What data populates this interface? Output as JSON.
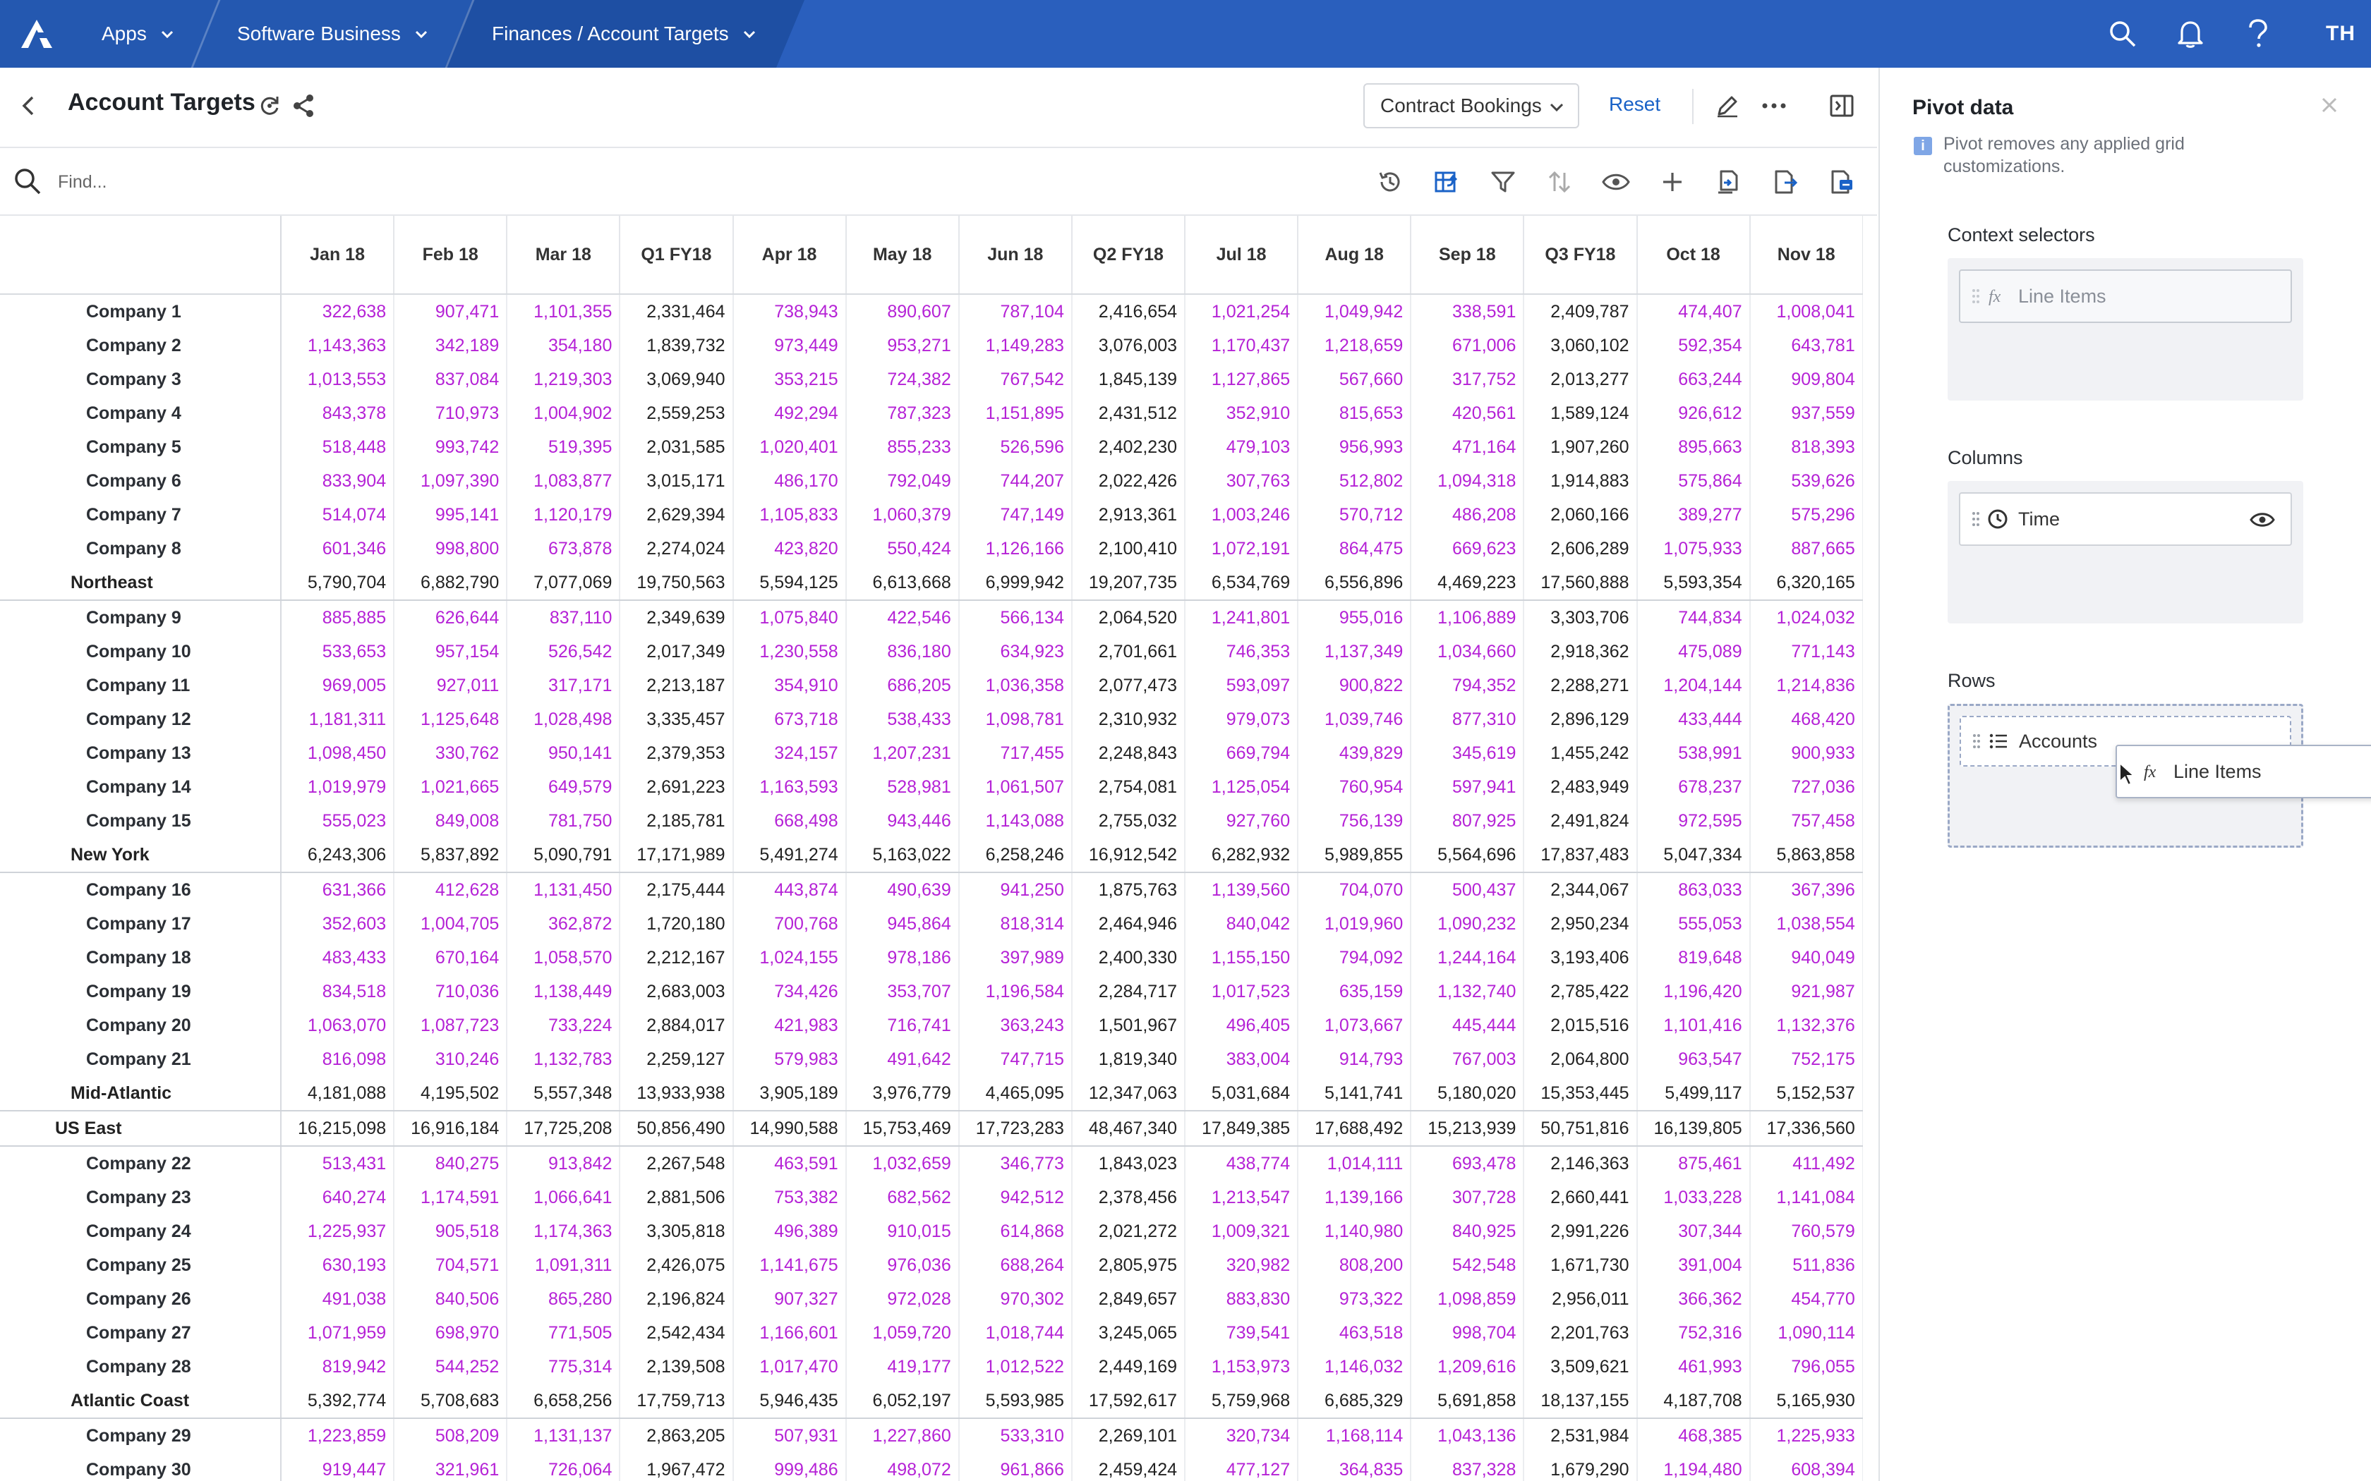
{
  "topbar": {
    "apps": "Apps",
    "workspace": "Software Business",
    "model": "Finances / Account Targets",
    "user_initials": "TH",
    "icons": [
      "search-icon",
      "bell-icon",
      "help-icon"
    ]
  },
  "header": {
    "title": "Account Targets",
    "view_selector": "Contract Bookings",
    "reset": "Reset"
  },
  "search": {
    "placeholder": "Find..."
  },
  "grid": {
    "columns": [
      "Jan 18",
      "Feb 18",
      "Mar 18",
      "Q1 FY18",
      "Apr 18",
      "May 18",
      "Jun 18",
      "Q2 FY18",
      "Jul 18",
      "Aug 18",
      "Sep 18",
      "Q3 FY18",
      "Oct 18",
      "Nov 18"
    ],
    "rows": [
      {
        "label": "Company 1",
        "type": "company",
        "values": [
          "322,638",
          "907,471",
          "1,101,355",
          "2,331,464",
          "738,943",
          "890,607",
          "787,104",
          "2,416,654",
          "1,021,254",
          "1,049,942",
          "338,591",
          "2,409,787",
          "474,407",
          "1,008,041"
        ]
      },
      {
        "label": "Company 2",
        "type": "company",
        "values": [
          "1,143,363",
          "342,189",
          "354,180",
          "1,839,732",
          "973,449",
          "953,271",
          "1,149,283",
          "3,076,003",
          "1,170,437",
          "1,218,659",
          "671,006",
          "3,060,102",
          "592,354",
          "643,781"
        ]
      },
      {
        "label": "Company 3",
        "type": "company",
        "values": [
          "1,013,553",
          "837,084",
          "1,219,303",
          "3,069,940",
          "353,215",
          "724,382",
          "767,542",
          "1,845,139",
          "1,127,865",
          "567,660",
          "317,752",
          "2,013,277",
          "663,244",
          "909,804"
        ]
      },
      {
        "label": "Company 4",
        "type": "company",
        "values": [
          "843,378",
          "710,973",
          "1,004,902",
          "2,559,253",
          "492,294",
          "787,323",
          "1,151,895",
          "2,431,512",
          "352,910",
          "815,653",
          "420,561",
          "1,589,124",
          "926,612",
          "937,559"
        ]
      },
      {
        "label": "Company 5",
        "type": "company",
        "values": [
          "518,448",
          "993,742",
          "519,395",
          "2,031,585",
          "1,020,401",
          "855,233",
          "526,596",
          "2,402,230",
          "479,103",
          "956,993",
          "471,164",
          "1,907,260",
          "895,663",
          "818,393"
        ]
      },
      {
        "label": "Company 6",
        "type": "company",
        "values": [
          "833,904",
          "1,097,390",
          "1,083,877",
          "3,015,171",
          "486,170",
          "792,049",
          "744,207",
          "2,022,426",
          "307,763",
          "512,802",
          "1,094,318",
          "1,914,883",
          "575,864",
          "539,626"
        ]
      },
      {
        "label": "Company 7",
        "type": "company",
        "values": [
          "514,074",
          "995,141",
          "1,120,179",
          "2,629,394",
          "1,105,833",
          "1,060,379",
          "747,149",
          "2,913,361",
          "1,003,246",
          "570,712",
          "486,208",
          "2,060,166",
          "389,277",
          "575,296"
        ]
      },
      {
        "label": "Company 8",
        "type": "company",
        "values": [
          "601,346",
          "998,800",
          "673,878",
          "2,274,024",
          "423,820",
          "550,424",
          "1,126,166",
          "2,100,410",
          "1,072,191",
          "864,475",
          "669,623",
          "2,606,289",
          "1,075,933",
          "887,665"
        ]
      },
      {
        "label": "Northeast",
        "type": "region",
        "values": [
          "5,790,704",
          "6,882,790",
          "7,077,069",
          "19,750,563",
          "5,594,125",
          "6,613,668",
          "6,999,942",
          "19,207,735",
          "6,534,769",
          "6,556,896",
          "4,469,223",
          "17,560,888",
          "5,593,354",
          "6,320,165"
        ]
      },
      {
        "label": "Company 9",
        "type": "company",
        "values": [
          "885,885",
          "626,644",
          "837,110",
          "2,349,639",
          "1,075,840",
          "422,546",
          "566,134",
          "2,064,520",
          "1,241,801",
          "955,016",
          "1,106,889",
          "3,303,706",
          "744,834",
          "1,024,032"
        ]
      },
      {
        "label": "Company 10",
        "type": "company",
        "values": [
          "533,653",
          "957,154",
          "526,542",
          "2,017,349",
          "1,230,558",
          "836,180",
          "634,923",
          "2,701,661",
          "746,353",
          "1,137,349",
          "1,034,660",
          "2,918,362",
          "475,089",
          "771,143"
        ]
      },
      {
        "label": "Company 11",
        "type": "company",
        "values": [
          "969,005",
          "927,011",
          "317,171",
          "2,213,187",
          "354,910",
          "686,205",
          "1,036,358",
          "2,077,473",
          "593,097",
          "900,822",
          "794,352",
          "2,288,271",
          "1,204,144",
          "1,214,836"
        ]
      },
      {
        "label": "Company 12",
        "type": "company",
        "values": [
          "1,181,311",
          "1,125,648",
          "1,028,498",
          "3,335,457",
          "673,718",
          "538,433",
          "1,098,781",
          "2,310,932",
          "979,073",
          "1,039,746",
          "877,310",
          "2,896,129",
          "433,444",
          "468,420"
        ]
      },
      {
        "label": "Company 13",
        "type": "company",
        "values": [
          "1,098,450",
          "330,762",
          "950,141",
          "2,379,353",
          "324,157",
          "1,207,231",
          "717,455",
          "2,248,843",
          "669,794",
          "439,829",
          "345,619",
          "1,455,242",
          "538,991",
          "900,933"
        ]
      },
      {
        "label": "Company 14",
        "type": "company",
        "values": [
          "1,019,979",
          "1,021,665",
          "649,579",
          "2,691,223",
          "1,163,593",
          "528,981",
          "1,061,507",
          "2,754,081",
          "1,125,054",
          "760,954",
          "597,941",
          "2,483,949",
          "678,237",
          "727,036"
        ]
      },
      {
        "label": "Company 15",
        "type": "company",
        "values": [
          "555,023",
          "849,008",
          "781,750",
          "2,185,781",
          "668,498",
          "943,446",
          "1,143,088",
          "2,755,032",
          "927,760",
          "756,139",
          "807,925",
          "2,491,824",
          "972,595",
          "757,458"
        ]
      },
      {
        "label": "New York",
        "type": "region",
        "values": [
          "6,243,306",
          "5,837,892",
          "5,090,791",
          "17,171,989",
          "5,491,274",
          "5,163,022",
          "6,258,246",
          "16,912,542",
          "6,282,932",
          "5,989,855",
          "5,564,696",
          "17,837,483",
          "5,047,334",
          "5,863,858"
        ]
      },
      {
        "label": "Company 16",
        "type": "company",
        "values": [
          "631,366",
          "412,628",
          "1,131,450",
          "2,175,444",
          "443,874",
          "490,639",
          "941,250",
          "1,875,763",
          "1,139,560",
          "704,070",
          "500,437",
          "2,344,067",
          "863,033",
          "367,396"
        ]
      },
      {
        "label": "Company 17",
        "type": "company",
        "values": [
          "352,603",
          "1,004,705",
          "362,872",
          "1,720,180",
          "700,768",
          "945,864",
          "818,314",
          "2,464,946",
          "840,042",
          "1,019,960",
          "1,090,232",
          "2,950,234",
          "555,053",
          "1,038,554"
        ]
      },
      {
        "label": "Company 18",
        "type": "company",
        "values": [
          "483,433",
          "670,164",
          "1,058,570",
          "2,212,167",
          "1,024,155",
          "978,186",
          "397,989",
          "2,400,330",
          "1,155,150",
          "794,092",
          "1,244,164",
          "3,193,406",
          "819,648",
          "940,049"
        ]
      },
      {
        "label": "Company 19",
        "type": "company",
        "values": [
          "834,518",
          "710,036",
          "1,138,449",
          "2,683,003",
          "734,426",
          "353,707",
          "1,196,584",
          "2,284,717",
          "1,017,523",
          "635,159",
          "1,132,740",
          "2,785,422",
          "1,196,420",
          "921,987"
        ]
      },
      {
        "label": "Company 20",
        "type": "company",
        "values": [
          "1,063,070",
          "1,087,723",
          "733,224",
          "2,884,017",
          "421,983",
          "716,741",
          "363,243",
          "1,501,967",
          "496,405",
          "1,073,667",
          "445,444",
          "2,015,516",
          "1,101,416",
          "1,132,376"
        ]
      },
      {
        "label": "Company 21",
        "type": "company",
        "values": [
          "816,098",
          "310,246",
          "1,132,783",
          "2,259,127",
          "579,983",
          "491,642",
          "747,715",
          "1,819,340",
          "383,004",
          "914,793",
          "767,003",
          "2,064,800",
          "963,547",
          "752,175"
        ]
      },
      {
        "label": "Mid-Atlantic",
        "type": "region",
        "values": [
          "4,181,088",
          "4,195,502",
          "5,557,348",
          "13,933,938",
          "3,905,189",
          "3,976,779",
          "4,465,095",
          "12,347,063",
          "5,031,684",
          "5,141,741",
          "5,180,020",
          "15,353,445",
          "5,499,117",
          "5,152,537"
        ]
      },
      {
        "label": "US East",
        "type": "total",
        "values": [
          "16,215,098",
          "16,916,184",
          "17,725,208",
          "50,856,490",
          "14,990,588",
          "15,753,469",
          "17,723,283",
          "48,467,340",
          "17,849,385",
          "17,688,492",
          "15,213,939",
          "50,751,816",
          "16,139,805",
          "17,336,560"
        ]
      },
      {
        "label": "Company 22",
        "type": "company",
        "values": [
          "513,431",
          "840,275",
          "913,842",
          "2,267,548",
          "463,591",
          "1,032,659",
          "346,773",
          "1,843,023",
          "438,774",
          "1,014,111",
          "693,478",
          "2,146,363",
          "875,461",
          "411,492"
        ]
      },
      {
        "label": "Company 23",
        "type": "company",
        "values": [
          "640,274",
          "1,174,591",
          "1,066,641",
          "2,881,506",
          "753,382",
          "682,562",
          "942,512",
          "2,378,456",
          "1,213,547",
          "1,139,166",
          "307,728",
          "2,660,441",
          "1,033,228",
          "1,141,084"
        ]
      },
      {
        "label": "Company 24",
        "type": "company",
        "values": [
          "1,225,937",
          "905,518",
          "1,174,363",
          "3,305,818",
          "496,389",
          "910,015",
          "614,868",
          "2,021,272",
          "1,009,321",
          "1,140,980",
          "840,925",
          "2,991,226",
          "307,344",
          "760,579"
        ]
      },
      {
        "label": "Company 25",
        "type": "company",
        "values": [
          "630,193",
          "704,571",
          "1,091,311",
          "2,426,075",
          "1,141,675",
          "976,036",
          "688,264",
          "2,805,975",
          "320,982",
          "808,200",
          "542,548",
          "1,671,730",
          "391,004",
          "511,836"
        ]
      },
      {
        "label": "Company 26",
        "type": "company",
        "values": [
          "491,038",
          "840,506",
          "865,280",
          "2,196,824",
          "907,327",
          "972,028",
          "970,302",
          "2,849,657",
          "883,830",
          "973,322",
          "1,098,859",
          "2,956,011",
          "366,362",
          "454,770"
        ]
      },
      {
        "label": "Company 27",
        "type": "company",
        "values": [
          "1,071,959",
          "698,970",
          "771,505",
          "2,542,434",
          "1,166,601",
          "1,059,720",
          "1,018,744",
          "3,245,065",
          "739,541",
          "463,518",
          "998,704",
          "2,201,763",
          "752,316",
          "1,090,114"
        ]
      },
      {
        "label": "Company 28",
        "type": "company",
        "values": [
          "819,942",
          "544,252",
          "775,314",
          "2,139,508",
          "1,017,470",
          "419,177",
          "1,012,522",
          "2,449,169",
          "1,153,973",
          "1,146,032",
          "1,209,616",
          "3,509,621",
          "461,993",
          "796,055"
        ]
      },
      {
        "label": "Atlantic Coast",
        "type": "region",
        "values": [
          "5,392,774",
          "5,708,683",
          "6,658,256",
          "17,759,713",
          "5,946,435",
          "6,052,197",
          "5,593,985",
          "17,592,617",
          "5,759,968",
          "6,685,329",
          "5,691,858",
          "18,137,155",
          "4,187,708",
          "5,165,930"
        ]
      },
      {
        "label": "Company 29",
        "type": "company",
        "values": [
          "1,223,859",
          "508,209",
          "1,131,137",
          "2,863,205",
          "507,931",
          "1,227,860",
          "533,310",
          "2,269,101",
          "320,734",
          "1,168,114",
          "1,043,136",
          "2,531,984",
          "468,385",
          "1,225,933"
        ]
      },
      {
        "label": "Company 30",
        "type": "company",
        "values": [
          "919,447",
          "321,961",
          "726,064",
          "1,967,472",
          "999,486",
          "498,072",
          "961,866",
          "2,459,424",
          "477,127",
          "364,835",
          "837,328",
          "1,679,290",
          "1,194,480",
          "608,394"
        ]
      }
    ]
  },
  "panel": {
    "title": "Pivot data",
    "info": "Pivot removes any applied grid customizations.",
    "context_label": "Context selectors",
    "context_chip": "Line Items",
    "columns_label": "Columns",
    "columns_chip": "Time",
    "rows_label": "Rows",
    "rows_chip": "Accounts",
    "dragging_chip": "Line Items"
  },
  "colors": {
    "topbar": "#2a5fbd",
    "input_cell": "#b522d6",
    "link": "#1a62c7"
  }
}
